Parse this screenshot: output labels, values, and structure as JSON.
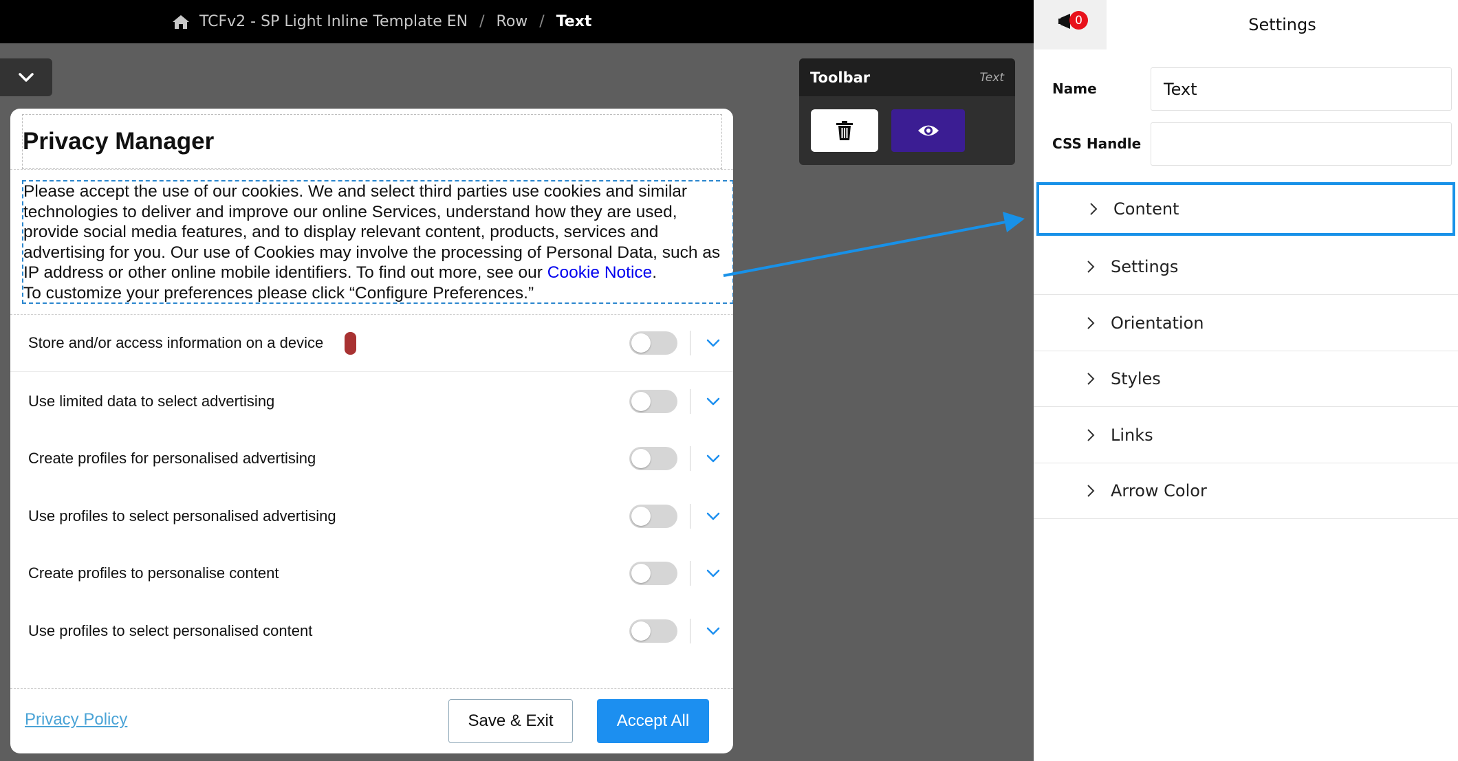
{
  "breadcrumb": {
    "items": [
      "TCFv2 - SP Light Inline Template EN",
      "Row"
    ],
    "current": "Text",
    "separator": "/"
  },
  "toolbar": {
    "title": "Toolbar",
    "element_type": "Text"
  },
  "modal": {
    "title": "Privacy Manager",
    "body": {
      "text_before_link": "Please accept the use of our cookies. We and select third parties use cookies and similar technologies to deliver and improve our online Services, understand how they are used, provide social media features, and to display relevant content, products, services and advertising for you. Our use of Cookies may involve the processing of Personal Data, such as IP address or other online mobile identifiers. To find out more, see our ",
      "link_text": "Cookie Notice",
      "text_after_link": ".",
      "second_line": "To customize your preferences please click “Configure Preferences.”"
    },
    "purposes": [
      {
        "label": "Store and/or access information on a device",
        "enabled": false
      },
      {
        "label": "Use limited data to select advertising",
        "enabled": false
      },
      {
        "label": "Create profiles for personalised advertising",
        "enabled": false
      },
      {
        "label": "Use profiles to select personalised advertising",
        "enabled": false
      },
      {
        "label": "Create profiles to personalise content",
        "enabled": false
      },
      {
        "label": "Use profiles to select personalised content",
        "enabled": false
      }
    ],
    "footer": {
      "privacy_policy": "Privacy Policy",
      "save_exit": "Save & Exit",
      "accept_all": "Accept All"
    }
  },
  "sidebar": {
    "title": "Settings",
    "notification_count": "0",
    "fields": {
      "name_label": "Name",
      "name_value": "Text",
      "css_handle_label": "CSS Handle",
      "css_handle_value": ""
    },
    "sections": [
      {
        "label": "Content",
        "highlighted": true
      },
      {
        "label": "Settings",
        "highlighted": false
      },
      {
        "label": "Orientation",
        "highlighted": false
      },
      {
        "label": "Styles",
        "highlighted": false
      },
      {
        "label": "Links",
        "highlighted": false
      },
      {
        "label": "Arrow Color",
        "highlighted": false
      }
    ]
  },
  "colors": {
    "accent_blue": "#1c8ff0",
    "preview_purple": "#3b1d93",
    "highlight_border": "#1891e8",
    "badge_red": "#e8111b"
  },
  "icons": [
    "home-icon",
    "chevron-down-icon",
    "trash-icon",
    "eye-icon",
    "notification-icon",
    "chevron-right-icon"
  ]
}
